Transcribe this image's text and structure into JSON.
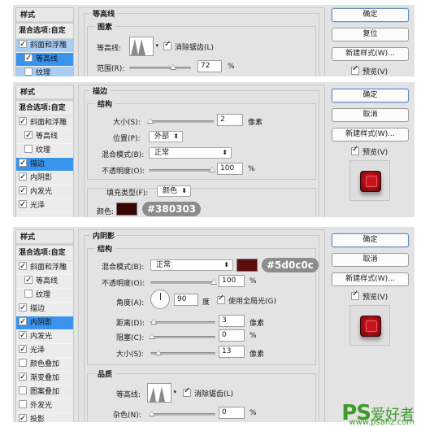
{
  "panel1": {
    "sidebar": {
      "header": "样式",
      "blend": "混合选项:自定",
      "items": [
        {
          "label": "斜面和浮雕",
          "checked": true
        },
        {
          "label": "等高线",
          "checked": true
        },
        {
          "label": "纹理",
          "checked": false
        }
      ]
    },
    "main": {
      "section_title": "等高线",
      "group_title": "图素",
      "contour_label": "等高线:",
      "antialias_label": "消除锯齿(L)",
      "antialias_checked": true,
      "range_label": "范围(R):",
      "range_value": "72",
      "range_unit": "%"
    },
    "buttons": {
      "ok": "确定",
      "reset": "复位",
      "new_style": "新建样式(W)...",
      "preview": "预览(V)"
    }
  },
  "panel2": {
    "sidebar": {
      "header": "样式",
      "blend": "混合选项:自定",
      "items": [
        {
          "label": "斜面和浮雕",
          "checked": true
        },
        {
          "label": "等高线",
          "checked": true
        },
        {
          "label": "纹理",
          "checked": false
        },
        {
          "label": "描边",
          "checked": true
        },
        {
          "label": "内阴影",
          "checked": true
        },
        {
          "label": "内发光",
          "checked": true
        },
        {
          "label": "光泽",
          "checked": true
        }
      ]
    },
    "main": {
      "section_title": "描边",
      "group_title": "结构",
      "size_label": "大小(S):",
      "size_value": "2",
      "size_unit": "像素",
      "position_label": "位置(P):",
      "position_value": "外部",
      "blend_label": "混合模式(B):",
      "blend_value": "正常",
      "opacity_label": "不透明度(O):",
      "opacity_value": "100",
      "opacity_unit": "%",
      "fill_type_label": "填充类型(F):",
      "fill_type_value": "颜色",
      "color_label": "颜色:",
      "color_hex": "#380303",
      "color": "#380303"
    },
    "buttons": {
      "ok": "确定",
      "cancel": "取消",
      "new_style": "新建样式(W)...",
      "preview": "预览(V)"
    }
  },
  "panel3": {
    "sidebar": {
      "header": "样式",
      "blend": "混合选项:自定",
      "items": [
        {
          "label": "斜面和浮雕",
          "checked": true
        },
        {
          "label": "等高线",
          "checked": true
        },
        {
          "label": "纹理",
          "checked": false
        },
        {
          "label": "描边",
          "checked": true
        },
        {
          "label": "内阴影",
          "checked": true
        },
        {
          "label": "内发光",
          "checked": true
        },
        {
          "label": "光泽",
          "checked": true
        },
        {
          "label": "颜色叠加",
          "checked": false
        },
        {
          "label": "渐变叠加",
          "checked": true
        },
        {
          "label": "图案叠加",
          "checked": false
        },
        {
          "label": "外发光",
          "checked": false
        },
        {
          "label": "投影",
          "checked": true
        }
      ]
    },
    "main": {
      "section_title": "内阴影",
      "group_title": "结构",
      "blend_label": "混合模式(B):",
      "blend_value": "正常",
      "color_hex": "#5d0c0c",
      "color": "#5d0c0c",
      "opacity_label": "不透明度(O):",
      "opacity_value": "100",
      "opacity_unit": "%",
      "angle_label": "角度(A):",
      "angle_value": "90",
      "angle_unit": "度",
      "global_light_label": "使用全局光(G)",
      "global_light_checked": true,
      "distance_label": "距离(D):",
      "distance_value": "3",
      "distance_unit": "像素",
      "choke_label": "阻塞(C):",
      "choke_value": "0",
      "choke_unit": "%",
      "size_label": "大小(S):",
      "size_value": "13",
      "size_unit": "像素",
      "quality_title": "品质",
      "contour_label": "等高线:",
      "antialias_label": "消除锯齿(L)",
      "antialias_checked": true,
      "noise_label": "杂色(N):",
      "noise_value": "0",
      "noise_unit": "%"
    },
    "buttons": {
      "ok": "确定",
      "cancel": "取消",
      "new_style": "新建样式(W)...",
      "preview": "预览(V)"
    }
  },
  "watermark": {
    "brand": "PS",
    "cn": "爱好者",
    "url": "www.psahz.com"
  }
}
